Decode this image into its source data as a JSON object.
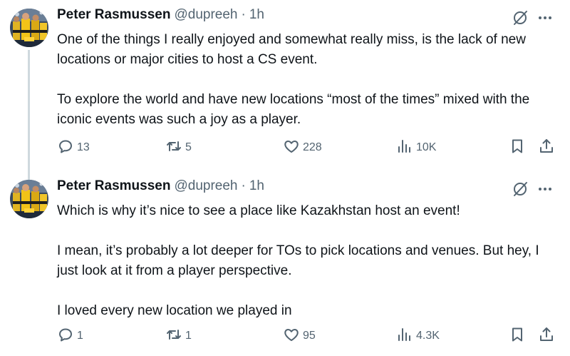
{
  "tweets": [
    {
      "author": {
        "name": "Peter Rasmussen",
        "handle": "@dupreeh"
      },
      "separator": "·",
      "time": "1h",
      "text": "One of the things I really enjoyed and somewhat really miss, is the lack of new locations or major cities to host a CS event.\n\nTo explore the world and have new locations “most of the times” mixed with the iconic events was such a joy as a player.",
      "stats": {
        "replies": "13",
        "reposts": "5",
        "likes": "228",
        "views": "10K"
      }
    },
    {
      "author": {
        "name": "Peter Rasmussen",
        "handle": "@dupreeh"
      },
      "separator": "·",
      "time": "1h",
      "text": "Which is why it’s nice to see a place like Kazakhstan host an event!\n\nI mean, it’s probably a lot deeper for TOs to pick locations and venues. But hey, I just look at it from a player perspective.\n\nI loved every new location we played in",
      "stats": {
        "replies": "1",
        "reposts": "1",
        "likes": "95",
        "views": "4.3K"
      }
    }
  ],
  "icons": {
    "reply": "reply-icon",
    "repost": "repost-icon",
    "like": "heart-icon",
    "views": "views-icon",
    "bookmark": "bookmark-icon",
    "share": "share-icon",
    "grok": "grok-icon",
    "more": "more-icon"
  },
  "colors": {
    "text": "#0f1419",
    "secondary": "#536471",
    "thread_line": "#cfd9de",
    "background": "#ffffff"
  }
}
